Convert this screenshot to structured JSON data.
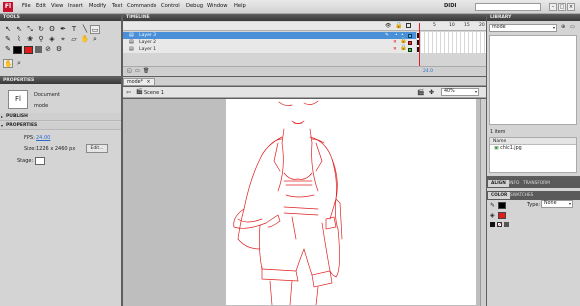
{
  "app": {
    "logo": "Fl"
  },
  "menu": [
    "File",
    "Edit",
    "View",
    "Insert",
    "Modify",
    "Text",
    "Commands",
    "Control",
    "Debug",
    "Window",
    "Help"
  ],
  "workspace": "DIDI",
  "panels": {
    "tools": "TOOLS",
    "properties": "PROPERTIES",
    "timeline": "TIMELINE",
    "library": "LIBRARY",
    "align_tabs": [
      "ALIGN",
      "INFO",
      "TRANSFORM"
    ],
    "color_tabs": [
      "COLOR",
      "SWATCHES"
    ]
  },
  "properties": {
    "doc_icon": "Fl",
    "doc_type": "Document",
    "doc_name": "mode",
    "publish": "PUBLISH",
    "props": "PROPERTIES",
    "fps_label": "FPS:",
    "fps_value": "24.00",
    "size_label": "Size:",
    "size_value": "1226 x 2460 px",
    "edit_button": "Edit...",
    "stage_label": "Stage:"
  },
  "timeline": {
    "layers": [
      {
        "name": "Layer 3",
        "selected": true,
        "color": "#4cc4ff"
      },
      {
        "name": "Layer 2",
        "selected": false,
        "color": "#e03030"
      },
      {
        "name": "Layer 1",
        "selected": false,
        "color": "#33c24a"
      }
    ],
    "frame_numbers": [
      "5",
      "10",
      "15",
      "20"
    ],
    "fps_readout": "24.0"
  },
  "document": {
    "tab": "mode*",
    "scene": "Scene 1",
    "zoom": "40%"
  },
  "library": {
    "doc_select": "mode",
    "count": "1 item",
    "column": "Name",
    "items": [
      "chic1.jpg"
    ]
  },
  "color_panel": {
    "type_label": "Type:",
    "type_value": "None"
  },
  "colors": {
    "accent": "#c8102e",
    "selection": "#4a90d9",
    "sketch": "#e02020"
  }
}
